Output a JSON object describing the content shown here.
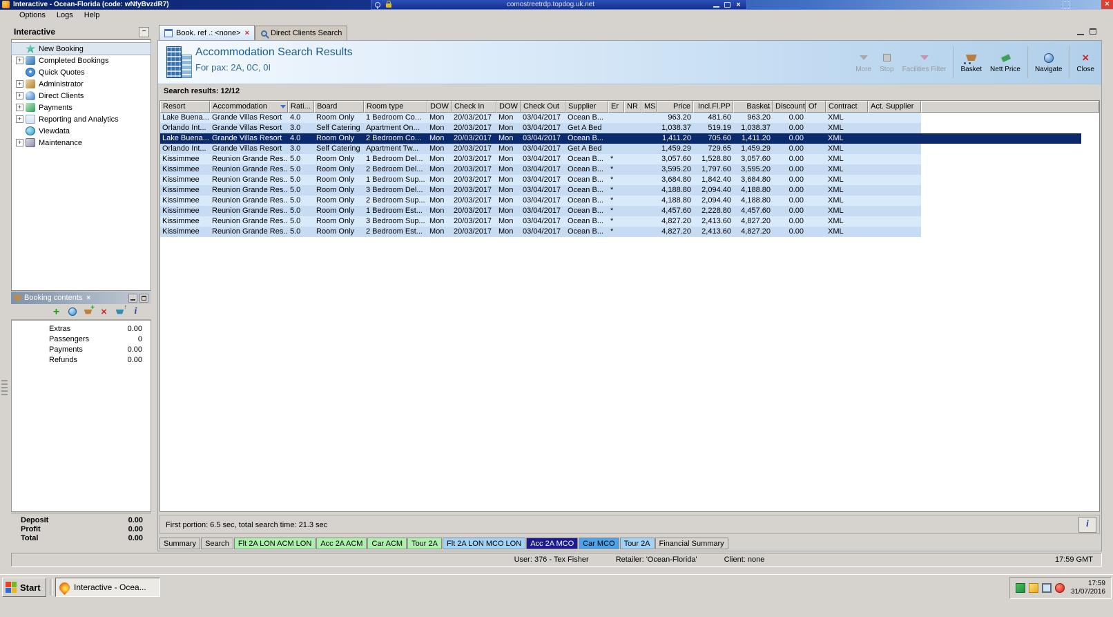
{
  "window": {
    "title": "Interactive - Ocean-Florida (code: wNfyBvzdR7)"
  },
  "rdp": {
    "url": "comostreetrdp.topdog.uk.net"
  },
  "menu": {
    "items": [
      {
        "label": "Options"
      },
      {
        "label": "Logs"
      },
      {
        "label": "Help"
      }
    ]
  },
  "sidebar": {
    "title": "Interactive",
    "items": [
      {
        "label": "New Booking",
        "icon": "new-booking-icon",
        "expandable": false,
        "selected": true
      },
      {
        "label": "Completed Bookings",
        "icon": "completed-bookings-icon",
        "expandable": true
      },
      {
        "label": "Quick Quotes",
        "icon": "quick-quotes-icon",
        "expandable": false
      },
      {
        "label": "Administrator",
        "icon": "administrator-icon",
        "expandable": true
      },
      {
        "label": "Direct Clients",
        "icon": "direct-clients-icon",
        "expandable": true
      },
      {
        "label": "Payments",
        "icon": "payments-icon",
        "expandable": true
      },
      {
        "label": "Reporting and Analytics",
        "icon": "reporting-icon",
        "expandable": true
      },
      {
        "label": "Viewdata",
        "icon": "viewdata-icon",
        "expandable": false
      },
      {
        "label": "Maintenance",
        "icon": "maintenance-icon",
        "expandable": true
      }
    ]
  },
  "booking_contents": {
    "title": "Booking contents",
    "toolbar_icons": [
      "add-icon",
      "world-icon",
      "add-to-basket-icon",
      "delete-icon",
      "basket-up-icon",
      "info-icon"
    ],
    "rows": [
      {
        "label": "Extras",
        "value": "0.00"
      },
      {
        "label": "Passengers",
        "value": "0"
      },
      {
        "label": "Payments",
        "value": "0.00"
      },
      {
        "label": "Refunds",
        "value": "0.00"
      }
    ],
    "totals": [
      {
        "label": "Deposit",
        "value": "0.00"
      },
      {
        "label": "Profit",
        "value": "0.00"
      },
      {
        "label": "Total",
        "value": "0.00"
      }
    ]
  },
  "tabs": [
    {
      "label": "Book. ref .: <none>",
      "icon": "booking-doc-icon",
      "active": true,
      "closable": true
    },
    {
      "label": "Direct Clients Search",
      "icon": "client-search-icon",
      "active": false
    }
  ],
  "header": {
    "title": "Accommodation Search Results",
    "subtitle": "For pax: 2A, 0C, 0I",
    "toolbar": [
      {
        "label": "More",
        "icon": "more-filter-icon",
        "disabled": true
      },
      {
        "label": "Stop",
        "icon": "stop-icon",
        "disabled": true
      },
      {
        "label": "Facilities Filter",
        "icon": "facilities-filter-icon",
        "disabled": true
      },
      {
        "label": "Basket",
        "icon": "basket-icon",
        "sep_before": true
      },
      {
        "label": "Nett Price",
        "icon": "nett-price-icon"
      },
      {
        "label": "Navigate",
        "icon": "navigate-icon",
        "sep_before": true
      },
      {
        "label": "Close",
        "icon": "close-red-icon",
        "sep_before": true
      }
    ]
  },
  "results": {
    "summary": "Search results: 12/12",
    "columns": [
      "Resort",
      "Accommodation",
      "Rati...",
      "Board",
      "Room type",
      "DOW",
      "Check In",
      "DOW",
      "Check Out",
      "Supplier",
      "Er",
      "NR",
      "MS",
      "Price",
      "Incl.Fl.PP",
      "Basket",
      "Discount",
      "Of",
      "Contract",
      "Act. Supplier"
    ],
    "selected_index": 2,
    "rows": [
      [
        "Lake Buena...",
        "Grande Villas Resort",
        "4.0",
        "Room Only",
        "1 Bedroom Co...",
        "Mon",
        "20/03/2017",
        "Mon",
        "03/04/2017",
        "Ocean B...",
        "",
        "",
        "",
        "963.20",
        "481.60",
        "963.20",
        "0.00",
        "",
        "XML",
        ""
      ],
      [
        "Orlando Int...",
        "Grande Villas Resort",
        "3.0",
        "Self Catering",
        "Apartment On...",
        "Mon",
        "20/03/2017",
        "Mon",
        "03/04/2017",
        "Get A Bed",
        "",
        "",
        "",
        "1,038.37",
        "519.19",
        "1,038.37",
        "0.00",
        "",
        "XML",
        ""
      ],
      [
        "Lake Buena...",
        "Grande Villas Resort",
        "4.0",
        "Room Only",
        "2 Bedroom Co...",
        "Mon",
        "20/03/2017",
        "Mon",
        "03/04/2017",
        "Ocean B...",
        "",
        "",
        "",
        "1,411.20",
        "705.60",
        "1,411.20",
        "0.00",
        "",
        "XML",
        ""
      ],
      [
        "Orlando Int...",
        "Grande Villas Resort",
        "3.0",
        "Self Catering",
        "Apartment Tw...",
        "Mon",
        "20/03/2017",
        "Mon",
        "03/04/2017",
        "Get A Bed",
        "",
        "",
        "",
        "1,459.29",
        "729.65",
        "1,459.29",
        "0.00",
        "",
        "XML",
        ""
      ],
      [
        "Kissimmee",
        "Reunion Grande Res...",
        "5.0",
        "Room Only",
        "1 Bedroom Del...",
        "Mon",
        "20/03/2017",
        "Mon",
        "03/04/2017",
        "Ocean B...",
        "*",
        "",
        "",
        "3,057.60",
        "1,528.80",
        "3,057.60",
        "0.00",
        "",
        "XML",
        ""
      ],
      [
        "Kissimmee",
        "Reunion Grande Res...",
        "5.0",
        "Room Only",
        "2 Bedroom Del...",
        "Mon",
        "20/03/2017",
        "Mon",
        "03/04/2017",
        "Ocean B...",
        "*",
        "",
        "",
        "3,595.20",
        "1,797.60",
        "3,595.20",
        "0.00",
        "",
        "XML",
        ""
      ],
      [
        "Kissimmee",
        "Reunion Grande Res...",
        "5.0",
        "Room Only",
        "1 Bedroom Sup...",
        "Mon",
        "20/03/2017",
        "Mon",
        "03/04/2017",
        "Ocean B...",
        "*",
        "",
        "",
        "3,684.80",
        "1,842.40",
        "3,684.80",
        "0.00",
        "",
        "XML",
        ""
      ],
      [
        "Kissimmee",
        "Reunion Grande Res...",
        "5.0",
        "Room Only",
        "3 Bedroom Del...",
        "Mon",
        "20/03/2017",
        "Mon",
        "03/04/2017",
        "Ocean B...",
        "*",
        "",
        "",
        "4,188.80",
        "2,094.40",
        "4,188.80",
        "0.00",
        "",
        "XML",
        ""
      ],
      [
        "Kissimmee",
        "Reunion Grande Res...",
        "5.0",
        "Room Only",
        "2 Bedroom Sup...",
        "Mon",
        "20/03/2017",
        "Mon",
        "03/04/2017",
        "Ocean B...",
        "*",
        "",
        "",
        "4,188.80",
        "2,094.40",
        "4,188.80",
        "0.00",
        "",
        "XML",
        ""
      ],
      [
        "Kissimmee",
        "Reunion Grande Res...",
        "5.0",
        "Room Only",
        "1 Bedroom Est...",
        "Mon",
        "20/03/2017",
        "Mon",
        "03/04/2017",
        "Ocean B...",
        "*",
        "",
        "",
        "4,457.60",
        "2,228.80",
        "4,457.60",
        "0.00",
        "",
        "XML",
        ""
      ],
      [
        "Kissimmee",
        "Reunion Grande Res...",
        "5.0",
        "Room Only",
        "3 Bedroom Sup...",
        "Mon",
        "20/03/2017",
        "Mon",
        "03/04/2017",
        "Ocean B...",
        "*",
        "",
        "",
        "4,827.20",
        "2,413.60",
        "4,827.20",
        "0.00",
        "",
        "XML",
        ""
      ],
      [
        "Kissimmee",
        "Reunion Grande Res...",
        "5.0",
        "Room Only",
        "2 Bedroom Est...",
        "Mon",
        "20/03/2017",
        "Mon",
        "03/04/2017",
        "Ocean B...",
        "*",
        "",
        "",
        "4,827.20",
        "2,413.60",
        "4,827.20",
        "0.00",
        "",
        "XML",
        ""
      ]
    ],
    "status": "First portion: 6.5 sec, total search time: 21.3 sec"
  },
  "bottom_tabs": [
    {
      "label": "Summary",
      "color": "#d6d3ce",
      "text": "#000000"
    },
    {
      "label": "Search",
      "color": "#d6d3ce",
      "text": "#000000"
    },
    {
      "label": "Flt 2A LON ACM LON",
      "color": "#abf0ab",
      "text": "#000000"
    },
    {
      "label": "Acc 2A ACM",
      "color": "#abf0ab",
      "text": "#000000"
    },
    {
      "label": "Car ACM",
      "color": "#abf0ab",
      "text": "#000000"
    },
    {
      "label": "Tour 2A",
      "color": "#abf0ab",
      "text": "#000000"
    },
    {
      "label": "Flt 2A LON MCO LON",
      "color": "#9fd4f6",
      "text": "#000000"
    },
    {
      "label": "Acc 2A MCO",
      "color": "#1c1c90",
      "text": "#ffffff",
      "selected": true
    },
    {
      "label": "Car MCO",
      "color": "#4da2ea",
      "text": "#000000"
    },
    {
      "label": "Tour 2A",
      "color": "#9fd4f6",
      "text": "#000000"
    },
    {
      "label": "Financial Summary",
      "color": "#d6d3ce",
      "text": "#000000"
    }
  ],
  "status_bar": {
    "user": "User: 376 - Tex Fisher",
    "retailer": "Retailer: 'Ocean-Florida'",
    "client": "Client: none",
    "time": "17:59 GMT"
  },
  "taskbar": {
    "start_label": "Start",
    "task_label": "Interactive - Ocea...",
    "tray_icons": [
      "network-icon",
      "security-icon",
      "display-icon",
      "alarm-icon"
    ],
    "clock_time": "17:59",
    "clock_date": "31/07/2016"
  }
}
